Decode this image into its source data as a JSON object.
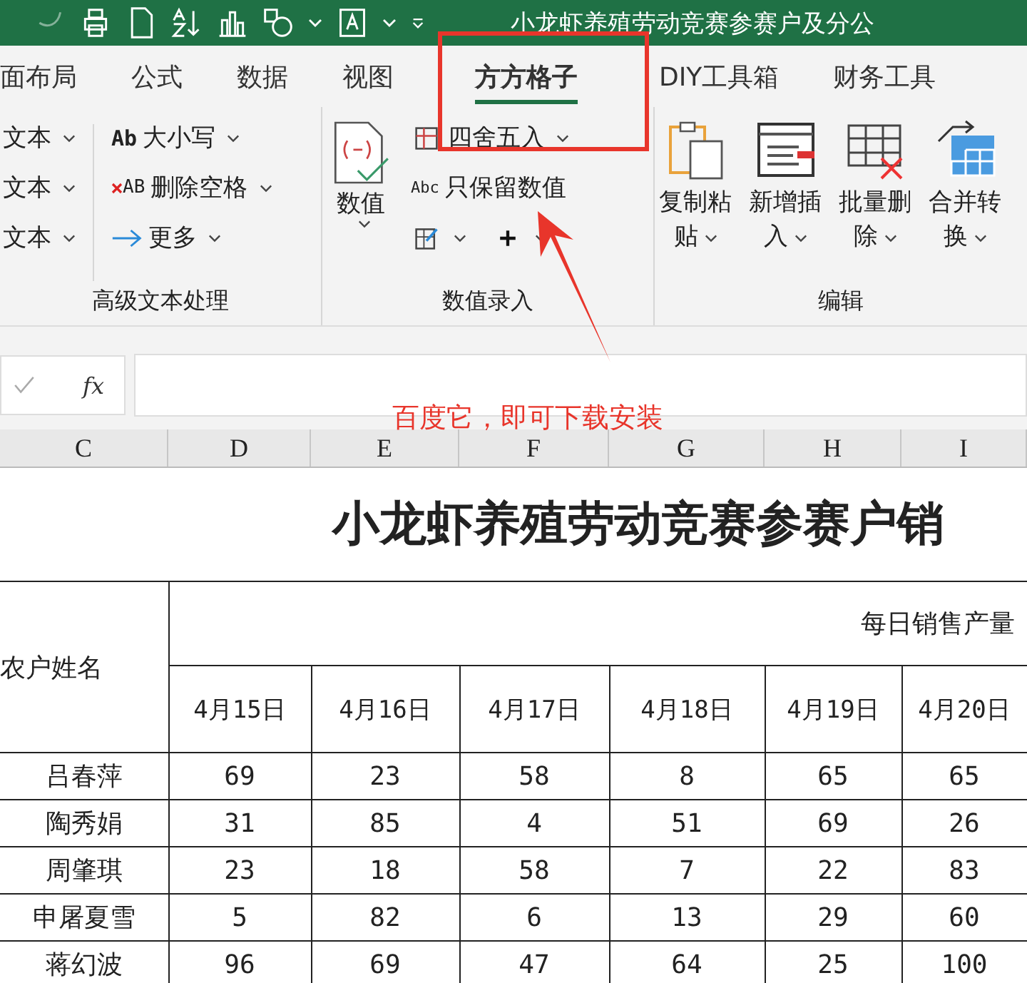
{
  "title_bar": {
    "title": "小龙虾养殖劳动竞赛参赛户及分公"
  },
  "tabs": [
    {
      "label": "面布局",
      "selected": false
    },
    {
      "label": "公式",
      "selected": false
    },
    {
      "label": "数据",
      "selected": false
    },
    {
      "label": "视图",
      "selected": false
    },
    {
      "label": "方方格子",
      "selected": true
    },
    {
      "label": "DIY工具箱",
      "selected": false
    },
    {
      "label": "财务工具",
      "selected": false
    }
  ],
  "ribbon": {
    "groups": [
      {
        "kind": "text",
        "label": "高级文本处理",
        "dropdowns": [
          "文本",
          "文本",
          "文本"
        ],
        "commands": [
          {
            "badge": "Ab",
            "label": "大小写"
          },
          {
            "badge": "AB",
            "label": "删除空格"
          },
          {
            "label": "更多"
          }
        ]
      },
      {
        "kind": "numeric",
        "label": "数值录入",
        "big": "数值",
        "commands": [
          {
            "label": "四舍五入"
          },
          {
            "badge": "Abc",
            "label": "只保留数值"
          }
        ]
      },
      {
        "kind": "edit",
        "label": "编辑",
        "buttons": [
          {
            "line1": "复制粘",
            "line2": "贴"
          },
          {
            "line1": "新增插",
            "line2": "入"
          },
          {
            "line1": "批量删",
            "line2": "除"
          },
          {
            "line1": "合并转",
            "line2": "换"
          }
        ]
      }
    ]
  },
  "formula_bar": {
    "function_label": "fx"
  },
  "annotation": {
    "label": "百度它，即可下载安装"
  },
  "column_headers": [
    "C",
    "D",
    "E",
    "F",
    "G",
    "H",
    "I"
  ],
  "sheet": {
    "title": "小龙虾养殖劳动竞赛参赛户销",
    "name_header": "农户姓名",
    "group_header": "每日销售产量",
    "dates": [
      "4月15日",
      "4月16日",
      "4月17日",
      "4月18日",
      "4月19日",
      "4月20日"
    ],
    "rows": [
      {
        "name": "吕春萍",
        "values": [
          "69",
          "23",
          "58",
          "8",
          "65",
          "65"
        ]
      },
      {
        "name": "陶秀娟",
        "values": [
          "31",
          "85",
          "4",
          "51",
          "69",
          "26"
        ]
      },
      {
        "name": "周肇琪",
        "values": [
          "23",
          "18",
          "58",
          "7",
          "22",
          "83"
        ]
      },
      {
        "name": "申屠夏雪",
        "values": [
          "5",
          "82",
          "6",
          "13",
          "29",
          "60"
        ]
      },
      {
        "name": "蒋幻波",
        "values": [
          "96",
          "69",
          "47",
          "64",
          "25",
          "100"
        ]
      }
    ]
  }
}
